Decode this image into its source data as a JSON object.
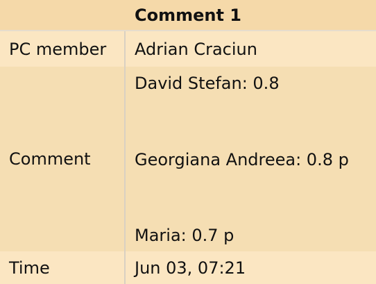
{
  "table": {
    "title": "Comment 1",
    "pc_member": {
      "label": "PC member",
      "value": "Adrian Craciun"
    },
    "comment": {
      "label": "Comment",
      "lines": [
        "David Stefan: 0.8",
        "Georgiana Andreea: 0.8 p",
        "Maria: 0.7 p"
      ]
    },
    "time": {
      "label": "Time",
      "value": "Jun 03, 07:21"
    }
  },
  "colors": {
    "header_background": "#f5d9a9",
    "row_background_light": "#fbe6c2",
    "row_background_dark": "#f5deb3",
    "divider": "#d9d0c2"
  }
}
